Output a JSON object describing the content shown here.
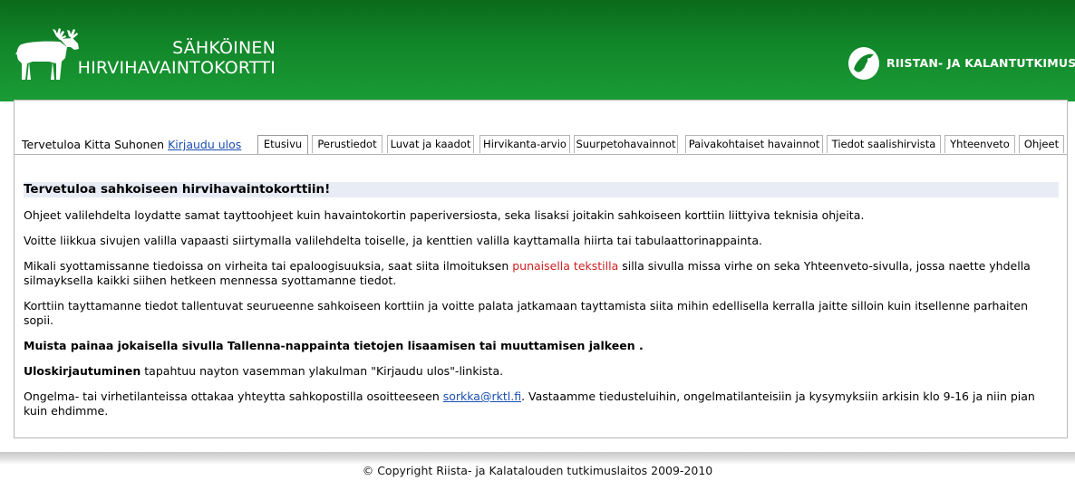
{
  "header": {
    "title_line1": "SÄHKÖINEN",
    "title_line2": "HIRVIHAVAINTOKORTTI",
    "org_name": "RIISTAN- JA KALANTUTKIMUS",
    "logo_icon": "moose-icon",
    "org_logo_icon": "leaf-fish-logo-icon"
  },
  "user": {
    "welcome": "Tervetuloa Kitta Suhonen",
    "logout": "Kirjaudu ulos"
  },
  "tabs": [
    {
      "label": "Etusivu",
      "active": true
    },
    {
      "label": "Perustiedot"
    },
    {
      "label": "Luvat ja kaadot"
    },
    {
      "label": "Hirvikanta-arvio"
    },
    {
      "label": "Suurpetohavainnot"
    },
    {
      "label": "Paivakohtaiset havainnot"
    },
    {
      "label": "Tiedot saalishirvista"
    },
    {
      "label": "Yhteenveto"
    },
    {
      "label": "Ohjeet"
    }
  ],
  "content": {
    "heading": "Tervetuloa sahkoiseen hirvihavaintokorttiin!",
    "p1": "Ohjeet valilehdelta loydatte samat tayttoohjeet kuin havaintokortin paperiversiosta, seka lisaksi joitakin sahkoiseen korttiin liittyiva teknisia ohjeita.",
    "p2": "Voitte liikkua sivujen valilla vapaasti siirtymalla valilehdelta toiselle, ja kenttien valilla kayttamalla hiirta tai tabulaattorinappainta.",
    "p3_before": "Mikali syottamissanne tiedoissa on virheita tai epaloogisuuksia, saat siita ilmoituksen ",
    "p3_red": "punaisella tekstilla",
    "p3_after": " silla sivulla missa virhe on seka Yhteenveto-sivulla, jossa naette yhdella silmayksella kaikki siihen hetkeen mennessa syottamanne tiedot.",
    "p4": "Korttiin tayttamanne tiedot tallentuvat seurueenne sahkoiseen korttiin ja voitte palata jatkamaan tayttamista siita mihin edellisella kerralla jaitte silloin kuin itsellenne parhaiten sopii.",
    "p5": "Muista painaa jokaisella sivulla Tallenna-nappainta tietojen lisaamisen tai muuttamisen jalkeen .",
    "p6_bold": "Uloskirjautuminen",
    "p6_rest": " tapahtuu nayton vasemman ylakulman \"Kirjaudu ulos\"-linkista.",
    "p7_before": "Ongelma- tai virhetilanteissa ottakaa yhteytta sahkopostilla osoitteeseen ",
    "p7_link": "sorkka@rktl.fi",
    "p7_after": ". Vastaamme tiedusteluihin, ongelmatilanteisiin ja kysymyksiin arkisin klo 9-16 ja niin pian kuin ehdimme."
  },
  "footer": {
    "copyright": "© Copyright Riista- ja Kalatalouden tutkimuslaitos 2009-2010"
  },
  "colors": {
    "header_green": "#12872a",
    "link_blue": "#1a4fb0",
    "error_red": "#cc1f1f",
    "heading_bg": "#e7ecf5"
  }
}
